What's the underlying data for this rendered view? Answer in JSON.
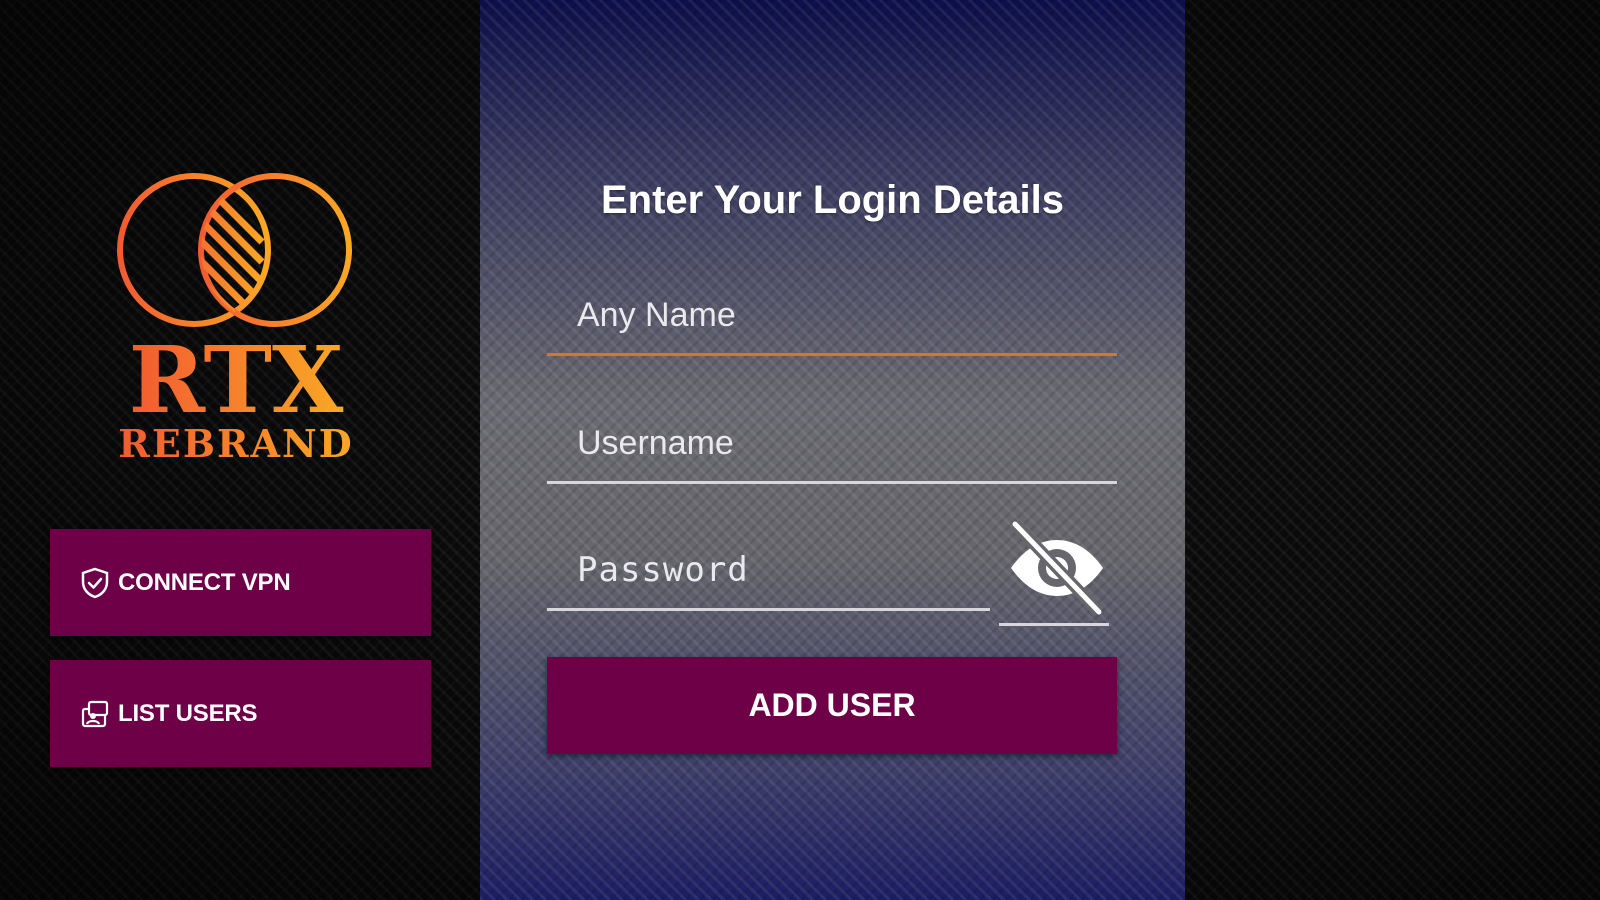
{
  "brand": {
    "name": "RTX",
    "sub": "REBRAND",
    "gradient_start": "#f25a32",
    "gradient_end": "#f9a825"
  },
  "sidebar": {
    "connect_vpn": {
      "label": "CONNECT VPN",
      "icon": "shield-check-icon"
    },
    "list_users": {
      "label": "LIST USERS",
      "icon": "users-list-icon"
    }
  },
  "login": {
    "title": "Enter Your Login Details",
    "name_placeholder": "Any Name",
    "username_placeholder": "Username",
    "password_placeholder": "Password",
    "visibility_icon": "eye-off-icon",
    "add_button_label": "ADD USER"
  },
  "colors": {
    "button_bg": "#6d0046",
    "focus_underline": "#d9752a",
    "underline": "#d8d8dc",
    "panel_top": "#0c0f4a",
    "panel_bottom": "#1c1e63"
  }
}
